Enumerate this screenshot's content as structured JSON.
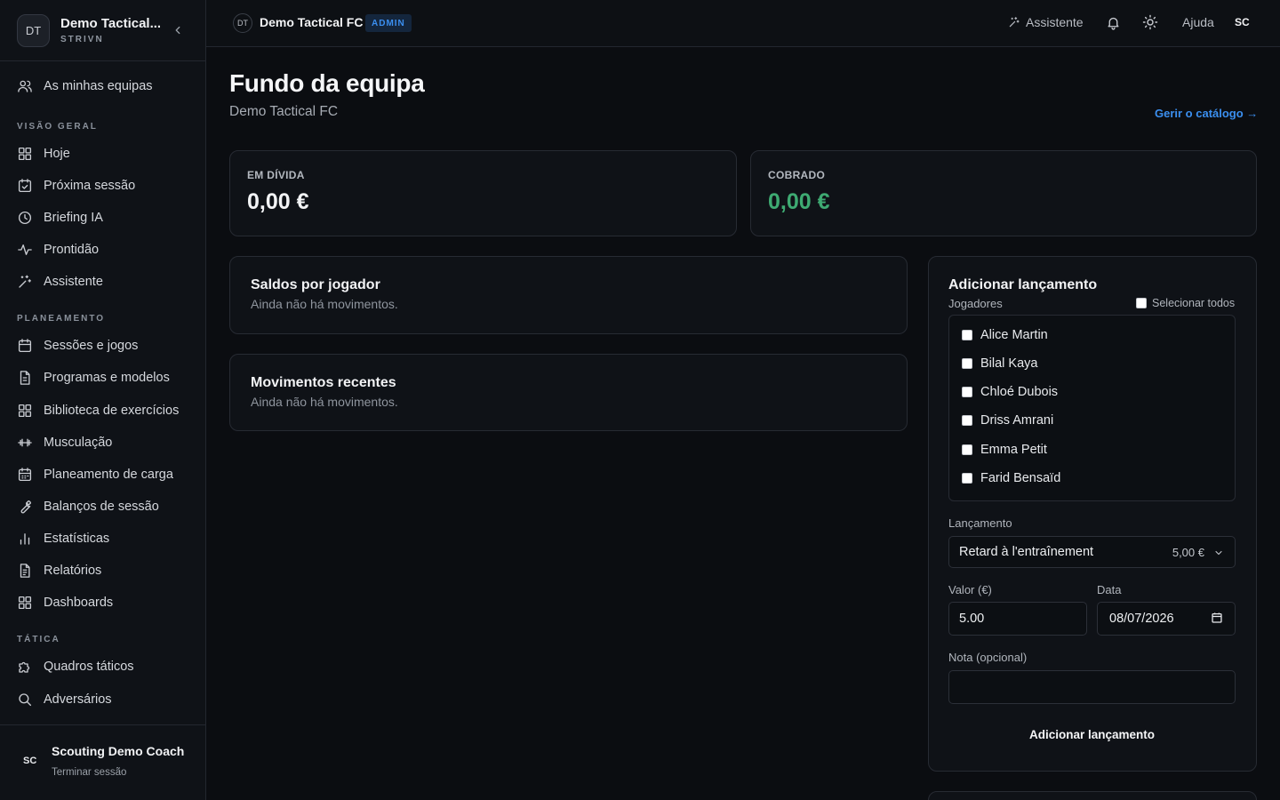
{
  "sidebar": {
    "team": {
      "initials": "DT",
      "name": "Demo Tactical...",
      "sub": "STRIVN"
    },
    "my_teams": "As minhas equipas",
    "sections": {
      "overview": "VISÃO GERAL",
      "planning": "PLANEAMENTO",
      "tactics": "TÁTICA"
    },
    "overview_items": [
      {
        "label": "Hoje",
        "icon": "grid-icon"
      },
      {
        "label": "Próxima sessão",
        "icon": "calendar-check-icon"
      },
      {
        "label": "Briefing IA",
        "icon": "clock-icon"
      },
      {
        "label": "Prontidão",
        "icon": "activity-icon"
      },
      {
        "label": "Assistente",
        "icon": "sparkles-icon"
      }
    ],
    "planning_items": [
      {
        "label": "Sessões e jogos",
        "icon": "calendar-icon"
      },
      {
        "label": "Programas e modelos",
        "icon": "file-icon"
      },
      {
        "label": "Biblioteca de exercícios",
        "icon": "grid-icon"
      },
      {
        "label": "Musculação",
        "icon": "dumbbell-icon"
      },
      {
        "label": "Planeamento de carga",
        "icon": "calendar-grid-icon"
      },
      {
        "label": "Balanços de sessão",
        "icon": "wrench-icon"
      },
      {
        "label": "Estatísticas",
        "icon": "bar-chart-icon"
      },
      {
        "label": "Relatórios",
        "icon": "file-text-icon"
      },
      {
        "label": "Dashboards",
        "icon": "grid-icon"
      }
    ],
    "tactics_items": [
      {
        "label": "Quadros táticos",
        "icon": "puzzle-icon"
      },
      {
        "label": "Adversários",
        "icon": "search-icon"
      }
    ],
    "user": {
      "initials": "SC",
      "name": "Scouting Demo Coach",
      "logout": "Terminar sessão"
    }
  },
  "topbar": {
    "team_initials": "DT",
    "team_name": "Demo Tactical FC",
    "badge": "ADMIN",
    "assistant": "Assistente",
    "help": "Ajuda",
    "user_initials": "SC"
  },
  "page": {
    "title": "Fundo da equipa",
    "subtitle": "Demo Tactical FC",
    "catalog_link": "Gerir o catálogo →"
  },
  "stats": {
    "debt_label": "EM DÍVIDA",
    "debt_value": "0,00 €",
    "collected_label": "COBRADO",
    "collected_value": "0,00 €"
  },
  "balances": {
    "title": "Saldos por jogador",
    "empty": "Ainda não há movimentos."
  },
  "movements": {
    "title": "Movimentos recentes",
    "empty": "Ainda não há movimentos."
  },
  "form": {
    "title": "Adicionar lançamento",
    "players_label": "Jogadores",
    "select_all": "Selecionar todos",
    "players": [
      "Alice Martin",
      "Bilal Kaya",
      "Chloé Dubois",
      "Driss Amrani",
      "Emma Petit",
      "Farid Bensaïd"
    ],
    "entry_label": "Lançamento",
    "entry_value": "Retard à l'entraînement",
    "entry_price": "5,00 €",
    "amount_label": "Valor (€)",
    "amount_value": "5.00",
    "date_label": "Data",
    "date_value": "08/07/2026",
    "note_label": "Nota (opcional)",
    "note_value": "",
    "submit": "Adicionar lançamento"
  },
  "colors": {
    "accent": "#3b8ff0",
    "positive": "#3eaa72",
    "background": "#0b0d11"
  }
}
